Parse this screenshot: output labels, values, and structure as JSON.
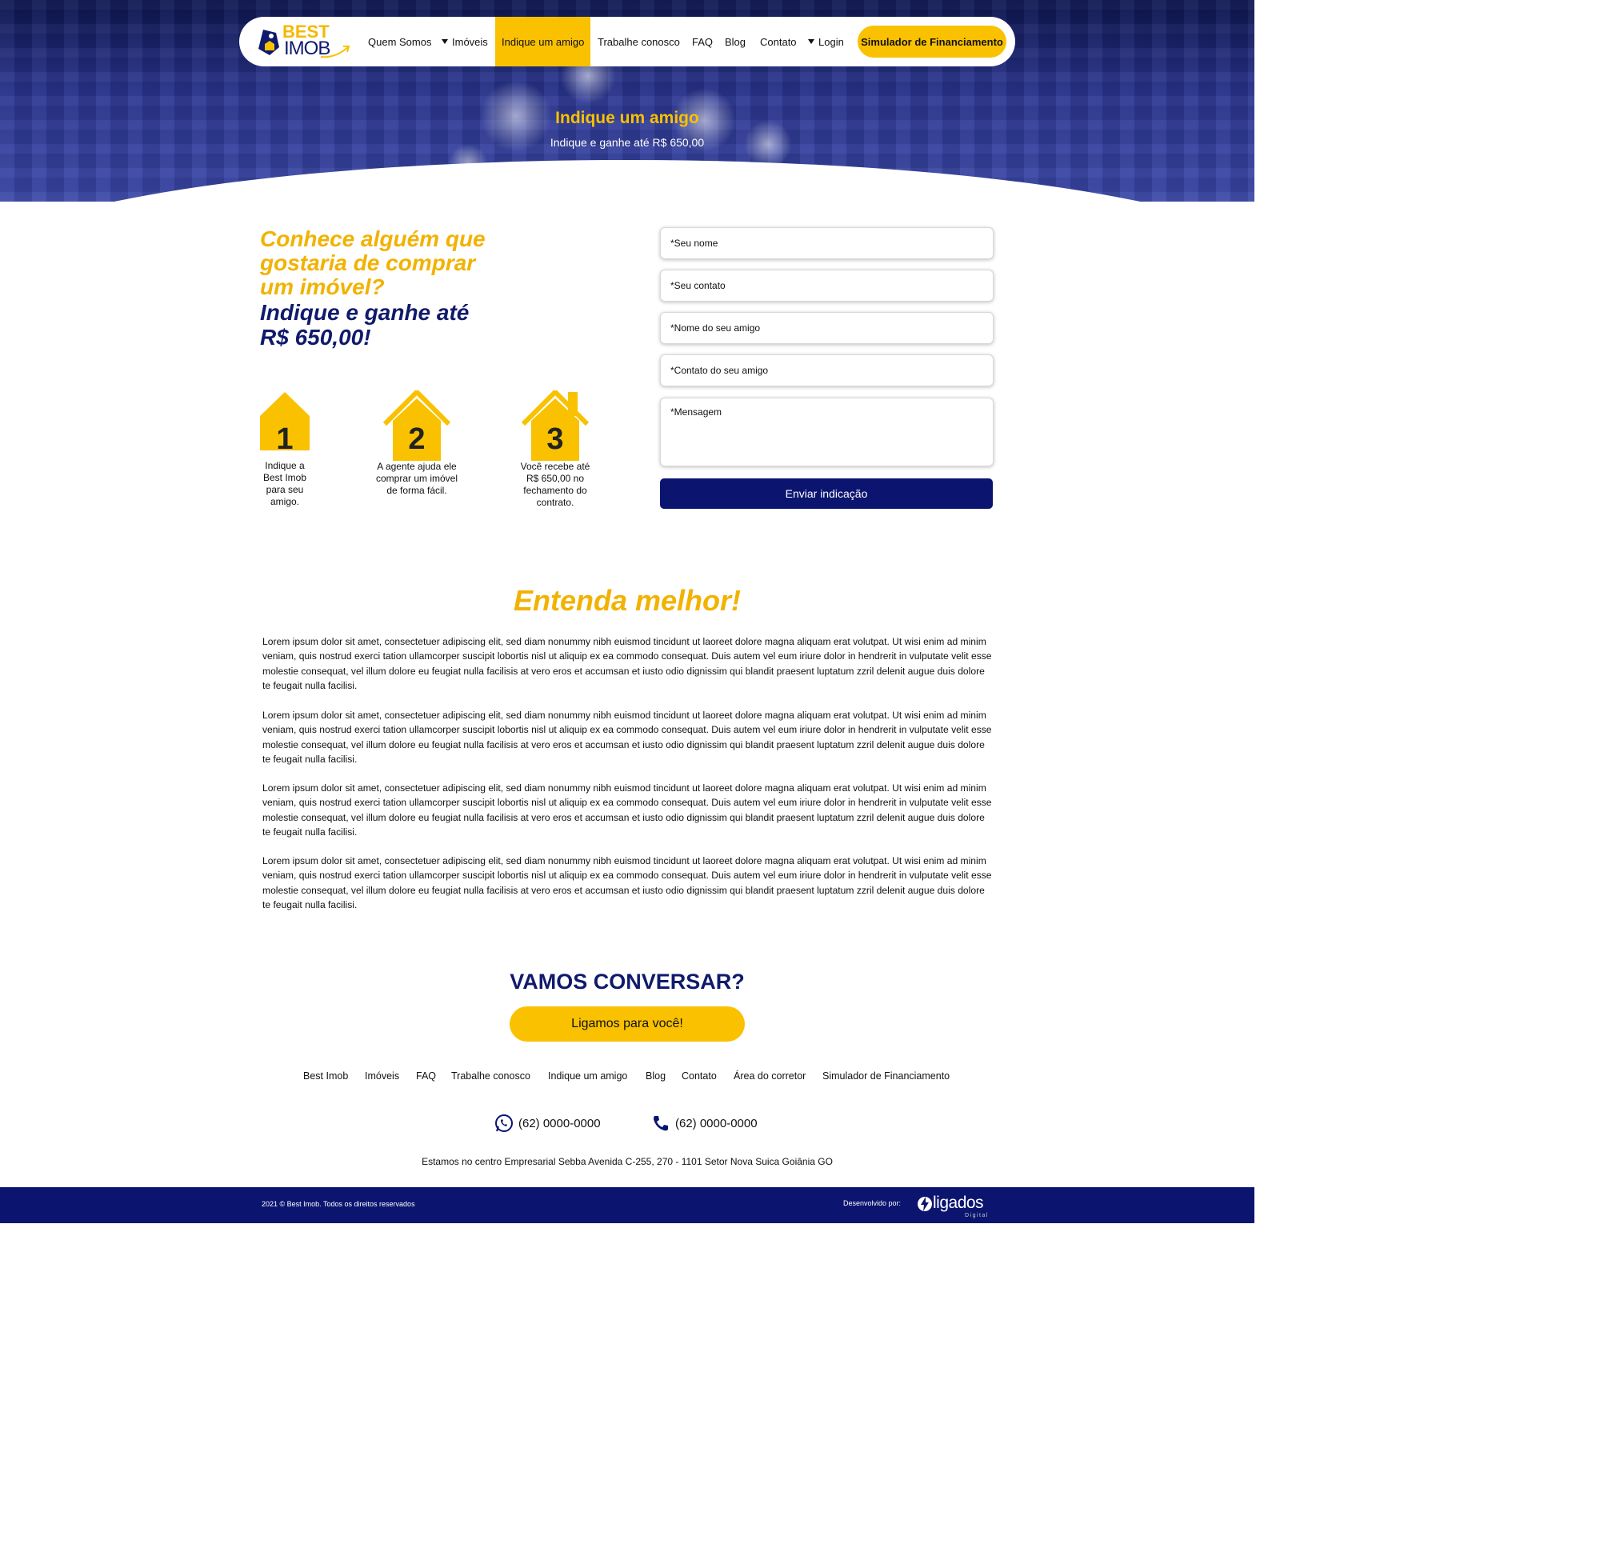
{
  "nav": {
    "logo_top": "BEST",
    "logo_bottom": "IMOB",
    "items": [
      "Quem Somos",
      "Imóveis",
      "Indique um amigo",
      "Trabalhe conosco",
      "FAQ",
      "Blog",
      "Contato",
      "Login"
    ],
    "cta": "Simulador de Financiamento"
  },
  "hero": {
    "title": "Indique um amigo",
    "subtitle": "Indique e ganhe até R$ 650,00"
  },
  "intro": {
    "headline_yellow": "Conhece alguém que gostaria de comprar um imóvel?",
    "headline_blue": "Indique e ganhe até R$ 650,00!"
  },
  "steps": [
    {
      "number": "1",
      "text": "Indique a Best Imob para seu amigo."
    },
    {
      "number": "2",
      "text": "A agente ajuda ele comprar um imóvel de forma fácil."
    },
    {
      "number": "3",
      "text": "Você recebe até R$ 650,00 no fechamento do contrato."
    }
  ],
  "form": {
    "name": "*Seu nome",
    "contact": "*Seu contato",
    "friend_name": "*Nome do seu amigo",
    "friend_contact": "*Contato do seu amigo",
    "message": "*Mensagem",
    "submit": "Enviar indicação"
  },
  "entenda": {
    "title": "Entenda melhor!",
    "paragraphs": [
      "Lorem ipsum dolor sit amet, consectetuer adipiscing elit, sed diam nonummy nibh euismod tincidunt ut laoreet dolore magna aliquam erat volutpat. Ut wisi enim ad minim veniam, quis nostrud exerci tation ullamcorper suscipit lobortis nisl ut aliquip ex ea commodo consequat. Duis autem vel eum iriure dolor in hendrerit in vulputate velit esse molestie consequat, vel illum dolore eu feugiat nulla facilisis at vero eros et accumsan et iusto odio dignissim qui blandit praesent luptatum zzril delenit augue duis dolore te feugait nulla facilisi.",
      "Lorem ipsum dolor sit amet, consectetuer adipiscing elit, sed diam nonummy nibh euismod tincidunt ut laoreet dolore magna aliquam erat volutpat. Ut wisi enim ad minim veniam, quis nostrud exerci tation ullamcorper suscipit lobortis nisl ut aliquip ex ea commodo consequat. Duis autem vel eum iriure dolor in hendrerit in vulputate velit esse molestie consequat, vel illum dolore eu feugiat nulla facilisis at vero eros et accumsan et iusto odio dignissim qui blandit praesent luptatum zzril delenit augue duis dolore te feugait nulla facilisi.",
      "Lorem ipsum dolor sit amet, consectetuer adipiscing elit, sed diam nonummy nibh euismod tincidunt ut laoreet dolore magna aliquam erat volutpat. Ut wisi enim ad minim veniam, quis nostrud exerci tation ullamcorper suscipit lobortis nisl ut aliquip ex ea commodo consequat. Duis autem vel eum iriure dolor in hendrerit in vulputate velit esse molestie consequat, vel illum dolore eu feugiat nulla facilisis at vero eros et accumsan et iusto odio dignissim qui blandit praesent luptatum zzril delenit augue duis dolore te feugait nulla facilisi.",
      "Lorem ipsum dolor sit amet, consectetuer adipiscing elit, sed diam nonummy nibh euismod tincidunt ut laoreet dolore magna aliquam erat volutpat. Ut wisi enim ad minim veniam, quis nostrud exerci tation ullamcorper suscipit lobortis nisl ut aliquip ex ea commodo consequat. Duis autem vel eum iriure dolor in hendrerit in vulputate velit esse molestie consequat, vel illum dolore eu feugiat nulla facilisis at vero eros et accumsan et iusto odio dignissim qui blandit praesent luptatum zzril delenit augue duis dolore te feugait nulla facilisi."
    ]
  },
  "cta": {
    "title": "VAMOS CONVERSAR?",
    "button": "Ligamos para você!"
  },
  "footer": {
    "links": [
      "Best Imob",
      "Imóveis",
      "FAQ",
      "Trabalhe conosco",
      "Indique um amigo",
      "Blog",
      "Contato",
      "Área do corretor",
      "Simulador de Financiamento"
    ],
    "whatsapp": "(62) 0000-0000",
    "phone": "(62) 0000-0000",
    "address": "Estamos no centro Empresarial Sebba Avenida C-255, 270 - 1101 Setor Nova Suica Goiânia GO",
    "copyright": "2021 © Best Imob. Todos os direitos reservados",
    "developed_by": "Desenvolvido por:",
    "dev_brand": "ligados",
    "dev_brand_sub": "Digital"
  },
  "colors": {
    "brand_yellow": "#f9c100",
    "brand_navy": "#0b1570"
  }
}
